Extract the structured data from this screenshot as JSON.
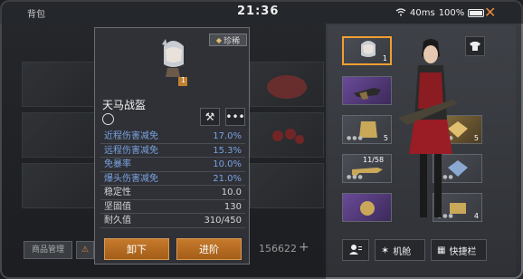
{
  "topbar": {
    "title": "背包",
    "clock": "21:36",
    "signal": "40ms",
    "battery": "100%"
  },
  "footer": {
    "manage_label": "商品管理",
    "money": "156622"
  },
  "tooltip": {
    "rarity": "珍稀",
    "item_name": "天马战盔",
    "portrait_count": "1",
    "stats": [
      {
        "label": "近程伤害减免",
        "value": "17.0%",
        "accent": true
      },
      {
        "label": "远程伤害减免",
        "value": "15.3%",
        "accent": true
      },
      {
        "label": "免暴率",
        "value": "10.0%",
        "accent": true
      },
      {
        "label": "爆头伤害减免",
        "value": "21.0%",
        "accent": true
      },
      {
        "label": "稳定性",
        "value": "10.0",
        "accent": false
      },
      {
        "label": "坚固值",
        "value": "130",
        "accent": false
      },
      {
        "label": "耐久值",
        "value": "310/450",
        "accent": false
      }
    ],
    "unequip_label": "卸下",
    "upgrade_label": "进阶"
  },
  "slots": [
    {
      "count": "1"
    },
    {
      "count": ""
    },
    {
      "count": "5"
    },
    {
      "count": "11/58"
    },
    {
      "count": "5"
    },
    {
      "count": ""
    },
    {
      "count": "4"
    }
  ],
  "right_buttons": {
    "mech_label": "机舱",
    "quickbar_label": "快捷栏"
  },
  "colors": {
    "accent_orange": "#e8883a",
    "stat_blue": "#7aa2df",
    "selected_border": "#f0a030"
  }
}
